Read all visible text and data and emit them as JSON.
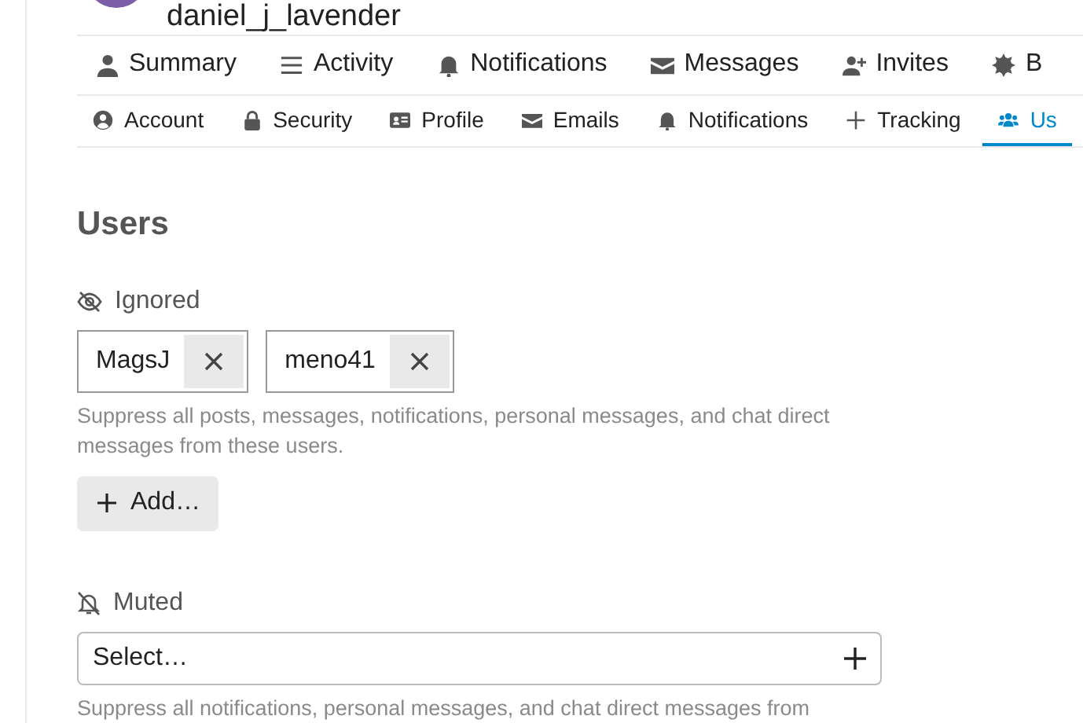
{
  "user": {
    "username": "daniel_j_lavender"
  },
  "main_nav": [
    {
      "label": "Summary"
    },
    {
      "label": "Activity"
    },
    {
      "label": "Notifications"
    },
    {
      "label": "Messages"
    },
    {
      "label": "Invites"
    },
    {
      "label": "B"
    }
  ],
  "sub_nav": [
    {
      "label": "Account",
      "selected": false
    },
    {
      "label": "Security",
      "selected": false
    },
    {
      "label": "Profile",
      "selected": false
    },
    {
      "label": "Emails",
      "selected": false
    },
    {
      "label": "Notifications",
      "selected": false
    },
    {
      "label": "Tracking",
      "selected": false
    },
    {
      "label": "Us",
      "selected": true
    }
  ],
  "section": {
    "title": "Users",
    "ignored": {
      "label": "Ignored",
      "chips": [
        "MagsJ",
        "meno41"
      ],
      "help": "Suppress all posts, messages, notifications, personal messages, and chat direct messages from these users.",
      "add_button": "Add…"
    },
    "muted": {
      "label": "Muted",
      "placeholder": "Select…",
      "help": "Suppress all notifications, personal messages, and chat direct messages from"
    }
  }
}
